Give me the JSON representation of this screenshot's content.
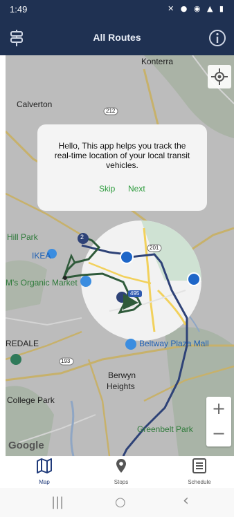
{
  "status": {
    "time": "1:49",
    "icons": "✕ ● ◉ ▲ ▮"
  },
  "header": {
    "title": "All Routes"
  },
  "map": {
    "labels": {
      "konterra": "Konterra",
      "calverton": "Calverton",
      "route212": "212",
      "hill_park": "Hill Park",
      "ikea": "IKEA",
      "organic_market": "M's Organic Market",
      "route201": "201",
      "route495": "495",
      "redale": "REDALE",
      "route193": "193",
      "beltway": "Beltway Plaza Mall",
      "berwyn": "Berwyn",
      "heights": "Heights",
      "college_park": "College Park",
      "greenbelt_park": "Greenbelt Park",
      "google": "Google"
    },
    "bus_marker": "2",
    "zoom_in": "+",
    "zoom_out": "−"
  },
  "tooltip": {
    "message": "Hello, This app helps you track the real-time location of your local transit vehicles.",
    "skip": "Skip",
    "next": "Next"
  },
  "nav": {
    "map": "Map",
    "stops": "Stops",
    "schedule": "Schedule"
  },
  "system_nav": {
    "recents": "|||",
    "home": "○",
    "back": "‹"
  },
  "colors": {
    "primary": "#1f3152",
    "accent": "#2e9c3e",
    "route_blue": "#2e4277",
    "route_green": "#2f5a3a",
    "marker": "#1e66c8"
  }
}
